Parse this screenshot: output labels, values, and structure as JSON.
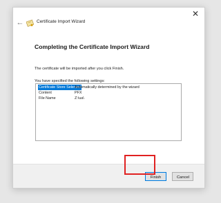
{
  "window": {
    "title": "Certificate Import Wizard",
    "close_symbol": "✕",
    "back_symbol": "←"
  },
  "content": {
    "heading": "Completing the Certificate Import Wizard",
    "description": "The certificate will be imported after you click Finish.",
    "settings_label": "You have specified the following settings:",
    "settings": [
      {
        "key": "Certificate Store Selected",
        "value": "Automatically determined by the wizard",
        "selected": true
      },
      {
        "key": "Content",
        "value": "PFX",
        "selected": false
      },
      {
        "key": "File Name",
        "value": "Z:\\ua\\",
        "selected": false
      }
    ]
  },
  "buttons": {
    "finish": "Finish",
    "cancel": "Cancel"
  },
  "colors": {
    "accent": "#0078d7",
    "highlight": "#e02020"
  },
  "icons": {
    "close": "close-icon",
    "back": "back-arrow-icon",
    "certificate": "certificate-icon"
  }
}
